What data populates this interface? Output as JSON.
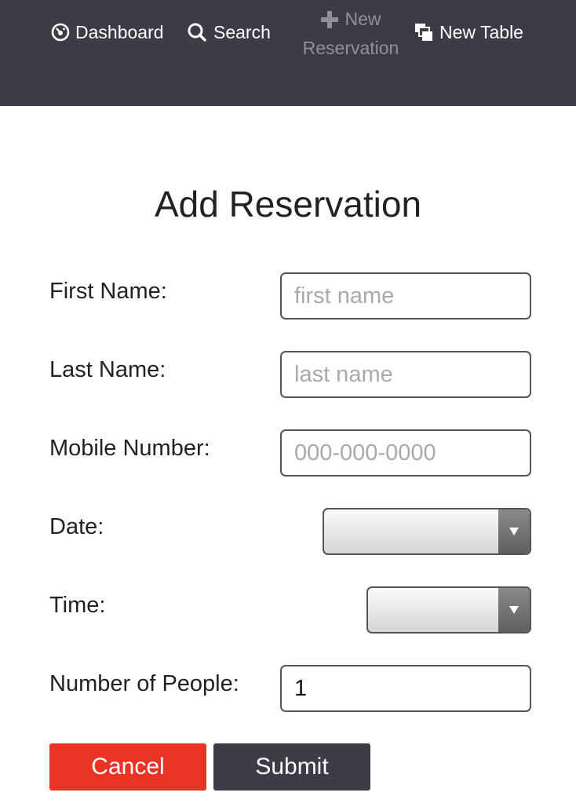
{
  "nav": {
    "dashboard": {
      "label": "Dashboard",
      "icon": "dashboard-gauge-icon"
    },
    "search": {
      "label": "Search",
      "icon": "search-icon"
    },
    "new_reservation": {
      "label_line1": "New",
      "label_line2": "Reservation",
      "icon": "plus-icon",
      "active": true
    },
    "new_table": {
      "label": "New Table",
      "icon": "table-stack-icon"
    }
  },
  "form": {
    "title": "Add Reservation",
    "first_name": {
      "label": "First Name:",
      "placeholder": "first name",
      "value": ""
    },
    "last_name": {
      "label": "Last Name:",
      "placeholder": "last name",
      "value": ""
    },
    "mobile_number": {
      "label": "Mobile Number:",
      "placeholder": "000-000-0000",
      "value": ""
    },
    "date": {
      "label": "Date:",
      "value": ""
    },
    "time": {
      "label": "Time:",
      "value": ""
    },
    "people": {
      "label": "Number of People:",
      "value": "1"
    },
    "cancel_label": "Cancel",
    "submit_label": "Submit"
  },
  "colors": {
    "topbar": "#3b3c45",
    "cancel": "#ea3323",
    "submit": "#3b3c45",
    "nav_inactive": "#8f9098"
  }
}
